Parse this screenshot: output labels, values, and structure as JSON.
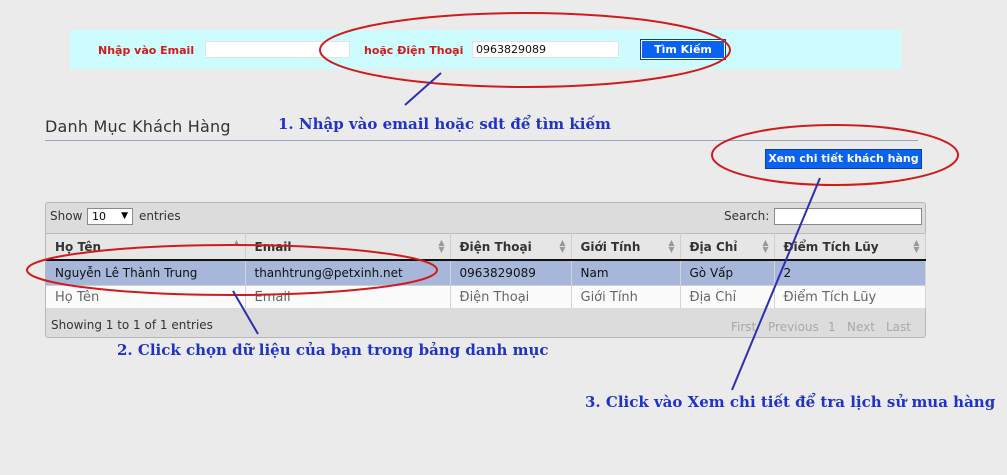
{
  "search": {
    "email_label": "Nhập vào Email",
    "email_value": "",
    "phone_label": "hoặc Điện Thoại",
    "phone_value": "0963829089",
    "button": "Tìm Kiếm"
  },
  "page": {
    "heading": "Danh Mục Khách Hàng",
    "detail_button": "Xem chi tiết khách hàng"
  },
  "table_controls": {
    "show_label": "Show",
    "show_value": "10",
    "entries_label": "entries",
    "search_label": "Search:",
    "search_value": "",
    "info": "Showing 1 to 1 of 1 entries"
  },
  "table": {
    "columns": [
      "Họ Tên",
      "Email",
      "Điện Thoại",
      "Giới Tính",
      "Địa Chỉ",
      "Điểm Tích Lũy"
    ],
    "rows": [
      [
        "Nguyễn Lê Thành Trung",
        "thanhtrung@petxinh.net",
        "0963829089",
        "Nam",
        "Gò Vấp",
        "2"
      ]
    ],
    "footer": [
      "Họ Tên",
      "Email",
      "Điện Thoại",
      "Giới Tính",
      "Địa Chỉ",
      "Điểm Tích Lũy"
    ]
  },
  "pagination": {
    "first": "First",
    "previous": "Previous",
    "page": "1",
    "next": "Next",
    "last": "Last"
  },
  "annotations": {
    "note1": "1. Nhập vào email hoặc sdt để tìm kiếm",
    "note2": "2. Click chọn dữ liệu của bạn trong bảng danh mục",
    "note3": "3. Click vào Xem chi tiết để tra lịch sử mua hàng",
    "ellipse_color": "#d11b1b",
    "arrow_color": "#2b2fb0"
  },
  "colors": {
    "band": "#ccfcfe",
    "button": "#0a63ee",
    "selected_row": "#a7b7d9"
  }
}
